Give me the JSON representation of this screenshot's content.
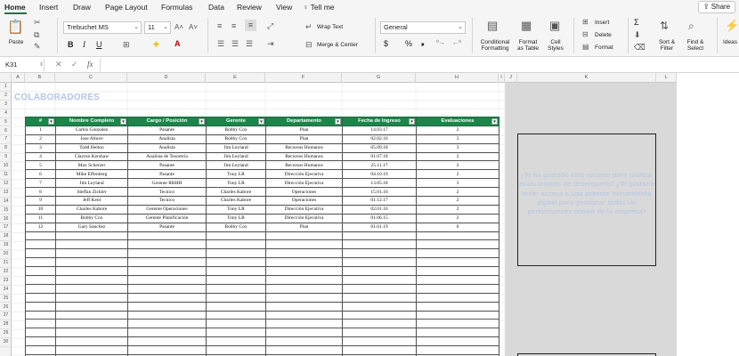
{
  "menu": {
    "tabs": [
      "Home",
      "Insert",
      "Draw",
      "Page Layout",
      "Formulas",
      "Data",
      "Review",
      "View"
    ],
    "tell_me": "Tell me",
    "share": "Share"
  },
  "ribbon": {
    "paste": "Paste",
    "font_name": "Trebuchet MS",
    "font_size": "11",
    "wrap_text": "Wrap Text",
    "merge_center": "Merge & Center",
    "number_format": "General",
    "conditional_formatting": [
      "Conditional",
      "Formatting"
    ],
    "format_as_table": [
      "Format",
      "as Table"
    ],
    "cell_styles": [
      "Cell",
      "Styles"
    ],
    "insert": "Insert",
    "delete": "Delete",
    "format": "Format",
    "sort_filter": [
      "Sort &",
      "Filter"
    ],
    "find_select": [
      "Find &",
      "Select"
    ],
    "ideas": "Ideas",
    "bold": "B",
    "italic": "I",
    "underline": "U",
    "currency": "$",
    "percent": "%",
    "comma": "❟",
    "sigma": "Σ"
  },
  "formula_bar": {
    "name_box": "K31",
    "fx": "fx"
  },
  "columns": [
    "A",
    "B",
    "C",
    "D",
    "E",
    "F",
    "G",
    "H",
    "I",
    "J",
    "K",
    "L"
  ],
  "rows": [
    "1",
    "2",
    "3",
    "4",
    "5",
    "6",
    "7",
    "8",
    "9",
    "10",
    "11",
    "12",
    "13",
    "14",
    "15",
    "16",
    "17",
    "18",
    "19",
    "20",
    "21",
    "22",
    "23",
    "24",
    "25",
    "26",
    "27",
    "28",
    "29",
    "30"
  ],
  "sheet": {
    "title": "COLABORADORES",
    "headers": [
      "#",
      "Nombre Completo",
      "Cargo / Posición",
      "Gerente",
      "Departamento",
      "Fecha de Ingreso",
      "Evaluaciones"
    ],
    "rows": [
      [
        "1",
        "Carlos Gonzalez",
        "Pasante",
        "Bobby Cox",
        "Plan",
        "14.03.17",
        "2"
      ],
      [
        "2",
        "Jose Altuve",
        "Analista",
        "Bobby Cox",
        "Plan",
        "02.02.16",
        "3"
      ],
      [
        "3",
        "Todd Helton",
        "Analista",
        "Jim Leyland",
        "Recursos Humanos",
        "05.09.18",
        "3"
      ],
      [
        "4",
        "Clayton Kershaw",
        "Analista de Tesorería",
        "Jim Leyland",
        "Recursos Humanos",
        "01.07.18",
        "2"
      ],
      [
        "5",
        "Max Scherzer",
        "Pasante",
        "Jim Leyland",
        "Recursos Humanos",
        "25.11.17",
        "2"
      ],
      [
        "6",
        "Mike Effenberg",
        "Pasante",
        "Tony LR",
        "Dirección Ejecutiva",
        "04.10.19",
        "2"
      ],
      [
        "7",
        "Jim Leyland",
        "Gerente RRHH",
        "Tony LR",
        "Dirección Ejecutiva",
        "13.05.18",
        "3"
      ],
      [
        "8",
        "Steffan Zickler",
        "Tecnico",
        "Charles Kabore",
        "Operaciones",
        "15.01.16",
        "2"
      ],
      [
        "9",
        "Jeff Kent",
        "Tecnico",
        "Charles Kabore",
        "Operaciones",
        "01.12.17",
        "2"
      ],
      [
        "10",
        "Charles Kabore",
        "Gerente Operaciones",
        "Tony LR",
        "Dirección Ejecutiva",
        "02.01.16",
        "2"
      ],
      [
        "11",
        "Bobby Cox",
        "Gerente Planificación",
        "Tony LR",
        "Dirección Ejecutiva",
        "01.06.15",
        "2"
      ],
      [
        "12",
        "Gary Sanchez",
        "Pasante",
        "Bobby Cox",
        "Plan",
        "01.01.19",
        "0"
      ]
    ],
    "empty_rows": 15
  },
  "callout": {
    "text": "¿Te ha gustado este recurso para realizar evaluaciones de desempeño? ¿Te gustaría tener acceso a una potente herramienta digital para gestionar todas las performances review de la empresa?"
  },
  "colors": {
    "header_green": "#1e8449",
    "accent_green": "#217346",
    "title_blue": "#b4c6e7",
    "gray_region": "#d9d9d9"
  }
}
